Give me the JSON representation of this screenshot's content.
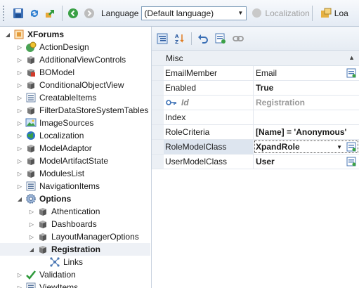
{
  "toolbar": {
    "language_label": "Language",
    "language_value": "(Default language)",
    "localization_label": "Localization",
    "load_label": "Loa"
  },
  "tree": {
    "items": [
      {
        "label": "XForums",
        "level": 0,
        "expander": "expanded",
        "icon": "app-root-icon",
        "bold": true
      },
      {
        "label": "ActionDesign",
        "level": 1,
        "expander": "collapsed",
        "icon": "action-design-icon"
      },
      {
        "label": "AdditionalViewControls",
        "level": 1,
        "expander": "collapsed",
        "icon": "cube-icon"
      },
      {
        "label": "BOModel",
        "level": 1,
        "expander": "collapsed",
        "icon": "bomodel-icon"
      },
      {
        "label": "ConditionalObjectView",
        "level": 1,
        "expander": "collapsed",
        "icon": "cube-icon"
      },
      {
        "label": "CreatableItems",
        "level": 1,
        "expander": "collapsed",
        "icon": "list-icon"
      },
      {
        "label": "FilterDataStoreSystemTables",
        "level": 1,
        "expander": "collapsed",
        "icon": "cube-icon"
      },
      {
        "label": "ImageSources",
        "level": 1,
        "expander": "collapsed",
        "icon": "image-sources-icon"
      },
      {
        "label": "Localization",
        "level": 1,
        "expander": "collapsed",
        "icon": "globe-icon"
      },
      {
        "label": "ModelAdaptor",
        "level": 1,
        "expander": "collapsed",
        "icon": "cube-icon"
      },
      {
        "label": "ModelArtifactState",
        "level": 1,
        "expander": "collapsed",
        "icon": "cube-icon"
      },
      {
        "label": "ModulesList",
        "level": 1,
        "expander": "collapsed",
        "icon": "cube-icon"
      },
      {
        "label": "NavigationItems",
        "level": 1,
        "expander": "collapsed",
        "icon": "list-icon"
      },
      {
        "label": "Options",
        "level": 1,
        "expander": "expanded",
        "icon": "options-gear-icon",
        "bold": true
      },
      {
        "label": "Athentication",
        "level": 2,
        "expander": "collapsed",
        "icon": "cube-icon"
      },
      {
        "label": "Dashboards",
        "level": 2,
        "expander": "collapsed",
        "icon": "cube-icon"
      },
      {
        "label": "LayoutManagerOptions",
        "level": 2,
        "expander": "collapsed",
        "icon": "cube-icon"
      },
      {
        "label": "Registration",
        "level": 2,
        "expander": "expanded",
        "icon": "cube-icon",
        "bold": true,
        "selected": true
      },
      {
        "label": "Links",
        "level": 3,
        "expander": "none",
        "icon": "links-icon"
      },
      {
        "label": "Validation",
        "level": 1,
        "expander": "collapsed",
        "icon": "checkmark-icon"
      },
      {
        "label": "ViewItems",
        "level": 1,
        "expander": "collapsed",
        "icon": "list-icon"
      }
    ]
  },
  "property_grid": {
    "category": "Misc",
    "rows": [
      {
        "name": "EmailMember",
        "value": "Email",
        "style": "normal",
        "button": "ellipsis"
      },
      {
        "name": "Enabled",
        "value": "True",
        "style": "bold",
        "button": "none"
      },
      {
        "name": "Id",
        "value": "Registration",
        "style": "dim",
        "button": "none",
        "key": true
      },
      {
        "name": "Index",
        "value": "",
        "style": "normal",
        "button": "none"
      },
      {
        "name": "RoleCriteria",
        "value": "[Name] = 'Anonymous'",
        "style": "bold",
        "button": "none"
      },
      {
        "name": "RoleModelClass",
        "value": "XpandRole",
        "style": "bold",
        "button": "dropdown",
        "active": true
      },
      {
        "name": "UserModelClass",
        "value": "User",
        "style": "bold",
        "button": "ellipsis"
      }
    ]
  },
  "colors": {
    "toolbar_bg": "#e4ebf4",
    "selection_bg": "#eef1f6",
    "grid_gutter": "#ecf0f5"
  }
}
